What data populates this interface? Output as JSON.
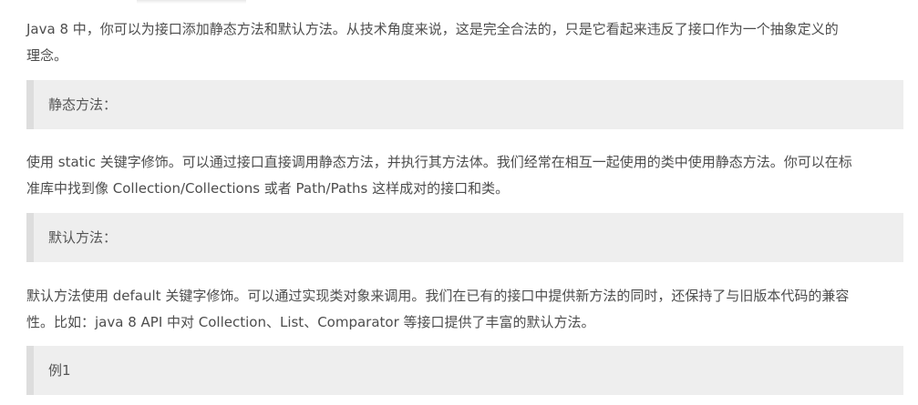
{
  "article": {
    "intro": {
      "line1": "Java 8 中，你可以为接口添加静态方法和默认方法。从技术角度来说，这是完全合法的，只是它看起来违反了接口作为一个抽象定义的",
      "line2": "理念。"
    },
    "quote_static": "静态方法：",
    "static_desc": {
      "line1": "使用 static 关键字修饰。可以通过接口直接调用静态方法，并执行其方法体。我们经常在相互一起使用的类中使用静态方法。你可以在标",
      "line2": "准库中找到像 Collection/Collections 或者 Path/Paths 这样成对的接口和类。"
    },
    "quote_default": "默认方法：",
    "default_desc": {
      "line1": "默认方法使用 default 关键字修饰。可以通过实现类对象来调用。我们在已有的接口中提供新方法的同时，还保持了与旧版本代码的兼容",
      "line2": "性。比如：java 8 API 中对 Collection、List、Comparator 等接口提供了丰富的默认方法。"
    },
    "quote_example": "例1"
  }
}
